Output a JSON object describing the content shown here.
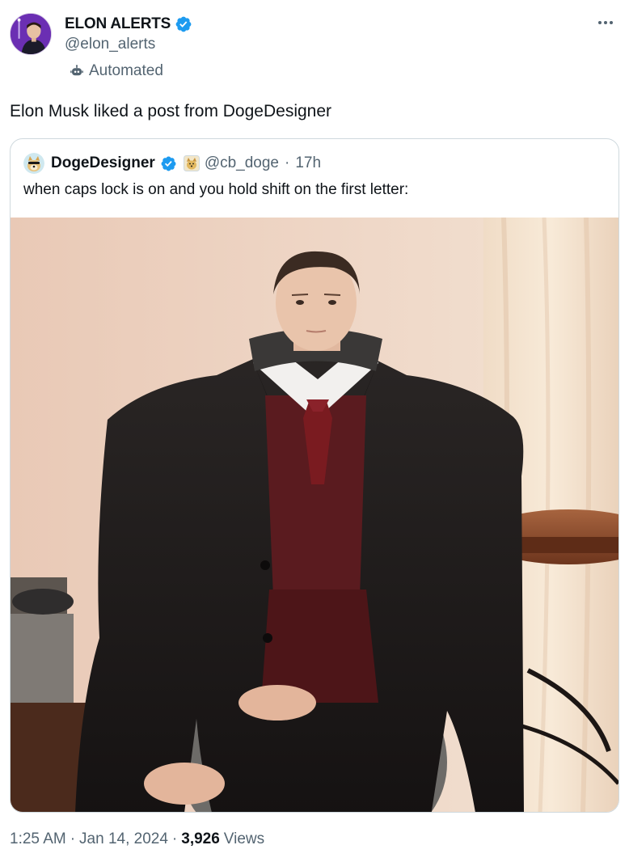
{
  "author": {
    "display_name": "ELON ALERTS",
    "handle": "@elon_alerts",
    "label": "Automated",
    "avatar_icon": "avatar-elon-musk",
    "verified_icon": "verified-badge-icon",
    "label_icon": "bot-icon"
  },
  "post": {
    "text": "Elon Musk liked a post from DogeDesigner"
  },
  "quoted_post": {
    "display_name": "DogeDesigner",
    "handle": "@cb_doge",
    "separator": "·",
    "time": "17h",
    "avatar_icon": "doge-avatar",
    "affiliate_badge_icon": "doge-affiliate-badge-icon",
    "text": "when caps lock is on and you hold shift on the first letter:",
    "media_description_icon": "meme-photo-oversized-coat"
  },
  "footer": {
    "time": "1:25 AM",
    "separator": "·",
    "date": "Jan 14, 2024",
    "views_count": "3,926",
    "views_label": "Views"
  },
  "colors": {
    "text_primary": "#0f1419",
    "text_secondary": "#536471",
    "verified_blue": "#1d9bf0",
    "border": "#cfd9de"
  }
}
